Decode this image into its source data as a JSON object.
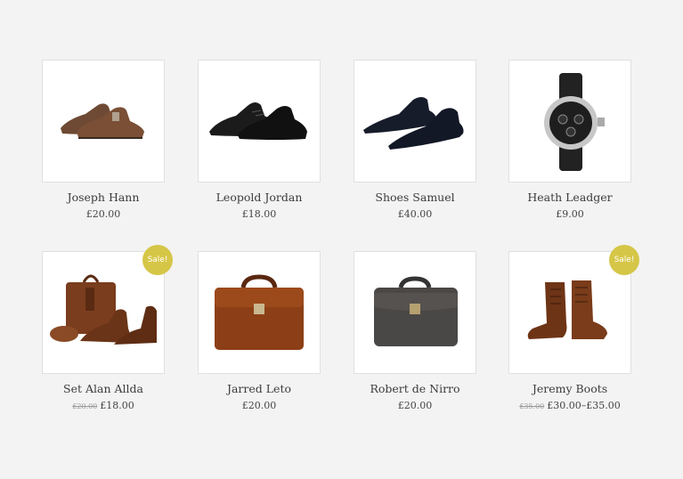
{
  "products": [
    {
      "name": "Joseph Hann",
      "price": "£20.00",
      "image": "brown-monk-strap-shoes"
    },
    {
      "name": "Leopold Jordan",
      "price": "£18.00",
      "image": "black-derby-shoes"
    },
    {
      "name": "Shoes Samuel",
      "price": "£40.00",
      "image": "navy-oxford-shoes"
    },
    {
      "name": "Heath Leadger",
      "price": "£9.00",
      "image": "chronograph-watch"
    },
    {
      "name": "Set Alan Allda",
      "old_price": "£20.00",
      "price": "£18.00",
      "badge": "Sale!",
      "image": "leather-bag-shoes-belt-set"
    },
    {
      "name": "Jarred Leto",
      "price": "£20.00",
      "image": "brown-croc-briefcase"
    },
    {
      "name": "Robert de Nirro",
      "price": "£20.00",
      "image": "grey-leather-briefcase"
    },
    {
      "name": "Jeremy Boots",
      "old_price": "£35.00",
      "price": "£30.00–£35.00",
      "badge": "Sale!",
      "image": "brown-lace-up-boots"
    }
  ],
  "colors": {
    "background": "#f3f3f3",
    "sale_badge": "#d6c647"
  }
}
